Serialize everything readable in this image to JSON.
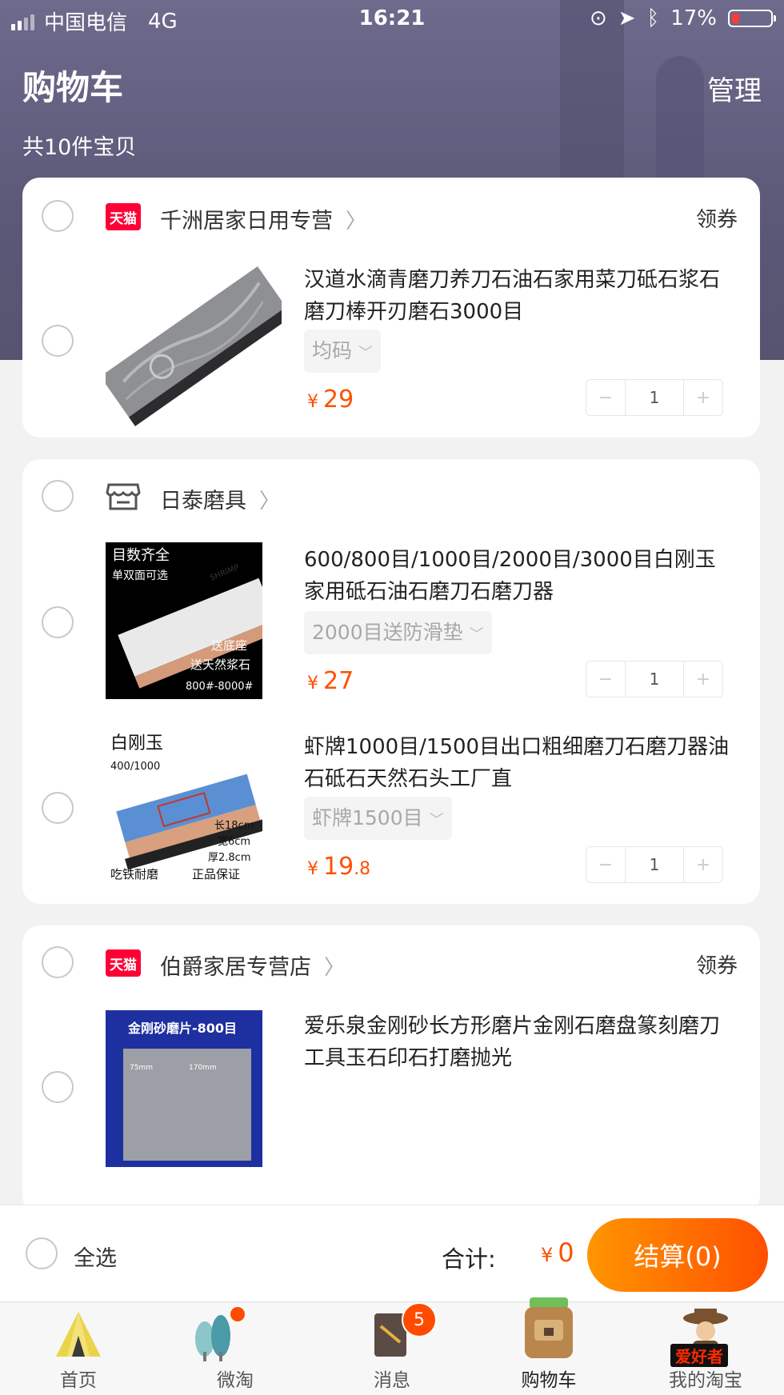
{
  "status_bar": {
    "carrier": "中国电信",
    "network": "4G",
    "time": "16:21",
    "battery": "17%"
  },
  "header": {
    "title": "购物车",
    "manage": "管理",
    "count": "共10件宝贝"
  },
  "shops": [
    {
      "name": "千洲居家日用专营",
      "badge": "天猫",
      "coupon": "领券",
      "items": [
        {
          "title": "汉道水滴青磨刀养刀石油石家用菜刀砥石浆石磨刀棒开刃磨石3000目",
          "sku": "均码",
          "price_int": "29",
          "price_dec": "",
          "qty": "1"
        }
      ]
    },
    {
      "name": "日泰磨具",
      "items": [
        {
          "title": "600/800目/1000目/2000目/3000目白刚玉家用砥石油石磨刀石磨刀器",
          "sku": "2000目送防滑垫",
          "price_int": "27",
          "price_dec": "",
          "qty": "1",
          "img_text": {
            "t1": "目数齐全",
            "t2": "单双面可选",
            "t3": "送底座",
            "t4": "送天然浆石",
            "t5": "800#-8000#",
            "brand": "SHRIMP"
          }
        },
        {
          "title": "虾牌1000目/1500目出口粗细磨刀石磨刀器油石砥石天然石头工厂直",
          "sku": "虾牌1500目",
          "price_int": "19",
          "price_dec": ".8",
          "qty": "1",
          "img_text": {
            "t1": "白刚玉",
            "t2": "400/1000",
            "t3": "长18cm",
            "t4": "宽6cm",
            "t5": "厚2.8cm",
            "t6": "吃铁耐磨",
            "t7": "正品保证"
          }
        }
      ]
    },
    {
      "name": "伯爵家居专营店",
      "badge": "天猫",
      "coupon": "领券",
      "items": [
        {
          "title": "爱乐泉金刚砂长方形磨片金刚石磨盘篆刻磨刀工具玉石印石打磨抛光",
          "img_text": {
            "t1": "金刚砂磨片-800目",
            "t2": "75mm",
            "t3": "170mm"
          }
        }
      ]
    }
  ],
  "footer": {
    "select_all": "全选",
    "total_label": "合计:",
    "total_currency": "¥",
    "total_value": "0",
    "checkout": "结算(0)"
  },
  "tabs": [
    {
      "label": "首页"
    },
    {
      "label": "微淘"
    },
    {
      "label": "消息",
      "badge": "5"
    },
    {
      "label": "购物车"
    },
    {
      "label": "我的淘宝",
      "overlay": "爱好者"
    }
  ],
  "currency": "¥",
  "colors": {
    "accent": "#ff5000",
    "header": "#615e80",
    "tmall": "#ff0036"
  }
}
